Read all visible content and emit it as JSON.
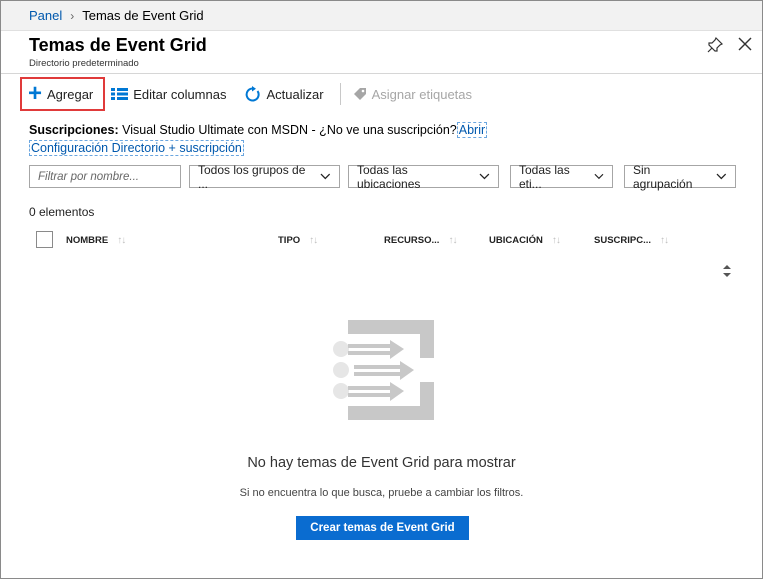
{
  "breadcrumb": {
    "home": "Panel",
    "current": "Temas de Event Grid"
  },
  "header": {
    "title": "Temas de Event Grid",
    "subtitle": "Directorio predeterminado"
  },
  "toolbar": {
    "add_label": "Agregar",
    "edit_columns_label": "Editar columnas",
    "refresh_label": "Actualizar",
    "assign_tags_label": "Asignar etiquetas"
  },
  "subscriptions": {
    "label": "Suscripciones:",
    "value": "Visual Studio Ultimate con MSDN",
    "question": " - ¿No ve una suscripción?",
    "open_link": "Abrir",
    "config_link": "Configuración Directorio + suscripción"
  },
  "filters": {
    "search_placeholder": "Filtrar por nombre...",
    "resource_groups": "Todos los grupos de ...",
    "locations": "Todas las ubicaciones",
    "tags": "Todas las eti...",
    "grouping": "Sin agrupación"
  },
  "list": {
    "count": "0 elementos",
    "columns": [
      "NOMBRE",
      "TIPO",
      "RECURSO...",
      "UBICACIÓN",
      "SUSCRIPC..."
    ]
  },
  "empty_state": {
    "title": "No hay temas de Event Grid para mostrar",
    "subtitle": "Si no encuentra lo que busca, pruebe a cambiar los filtros.",
    "button_label": "Crear temas de Event Grid"
  },
  "colors": {
    "accent": "#0a6cd0",
    "link": "#0058ad",
    "highlight": "#e03a3a"
  }
}
